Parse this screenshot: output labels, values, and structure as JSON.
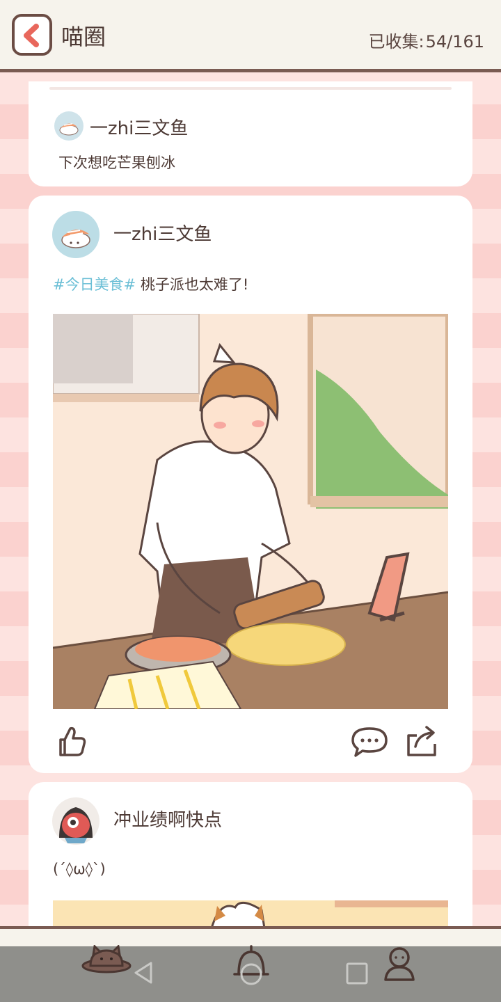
{
  "header": {
    "title": "喵圈",
    "collected_label": "已收集:",
    "collected_value": "54/161"
  },
  "posts": [
    {
      "author": "一zhi三文鱼",
      "text": "下次想吃芒果刨冰"
    },
    {
      "author": "一zhi三文鱼",
      "tag": "#今日美食#",
      "text": " 桃子派也太难了!"
    },
    {
      "author": "冲业绩啊快点",
      "text": "(´◊ω◊`)"
    }
  ],
  "icons": {
    "back": "back-arrow-icon",
    "like": "thumbs-up-icon",
    "comment": "speech-bubble-icon",
    "share": "share-icon",
    "nav_home": "cat-planet-icon",
    "nav_notify": "bell-icon",
    "nav_profile": "person-icon",
    "sys_back": "triangle-back-icon",
    "sys_home": "circle-home-icon",
    "sys_recent": "square-recent-icon"
  },
  "colors": {
    "accent": "#e8675c",
    "tag": "#6bbfd6",
    "border": "#7a5b52"
  }
}
